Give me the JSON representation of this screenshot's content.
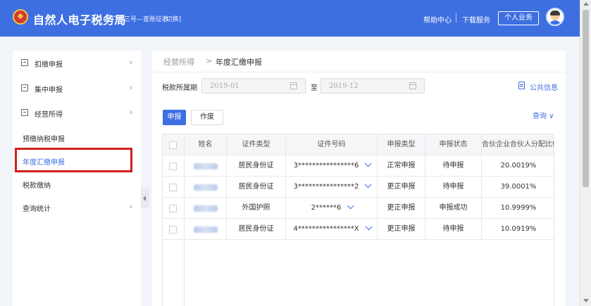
{
  "header": {
    "app_title": "自然人电子税务局",
    "region": "广东三号—查账征收",
    "switch_label": "[切换]",
    "help_label": "帮助中心",
    "download_label": "下载服务",
    "personal_button": "个人业务"
  },
  "sidebar": {
    "menu": [
      {
        "label": "扣缴申报",
        "icon": "document-icon"
      },
      {
        "label": "集中申报",
        "icon": "monitor-icon"
      },
      {
        "label": "经营所得",
        "icon": "briefcase-icon"
      }
    ],
    "sub_items": [
      {
        "label": "预缴纳税申报"
      },
      {
        "label": "年度汇缴申报",
        "active": true
      },
      {
        "label": "税款缴纳"
      },
      {
        "label": "查询统计"
      }
    ]
  },
  "breadcrumb": {
    "parent": "经营所得",
    "separator": ">",
    "current": "年度汇缴申报"
  },
  "filters": {
    "period_label": "税款所属期",
    "start_date": "2019-01",
    "to_label": "至",
    "end_date": "2019-12",
    "public_info_label": "公共信息"
  },
  "actions": {
    "declare_label": "申报",
    "void_label": "作废",
    "query_label": "查询 ∨"
  },
  "table": {
    "columns": [
      "姓名",
      "证件类型",
      "证件号码",
      "申报类型",
      "申报状态",
      "合伙企业合伙人分配比例"
    ],
    "rows": [
      {
        "id_type": "居民身份证",
        "id_number": "3****************6",
        "declare_type": "正常申报",
        "status": "待申报",
        "ratio": "20.0019%"
      },
      {
        "id_type": "居民身份证",
        "id_number": "3****************2",
        "declare_type": "更正申报",
        "status": "待申报",
        "ratio": "39.0001%"
      },
      {
        "id_type": "外国护照",
        "id_number": "2******6",
        "declare_type": "更正申报",
        "status": "申报成功",
        "ratio": "10.9999%"
      },
      {
        "id_type": "居民身份证",
        "id_number": "4****************X",
        "declare_type": "更正申报",
        "status": "待申报",
        "ratio": "10.0919%"
      }
    ]
  },
  "colors": {
    "brand_blue": "#3d6fe0",
    "highlight_red": "#d21f1f"
  }
}
